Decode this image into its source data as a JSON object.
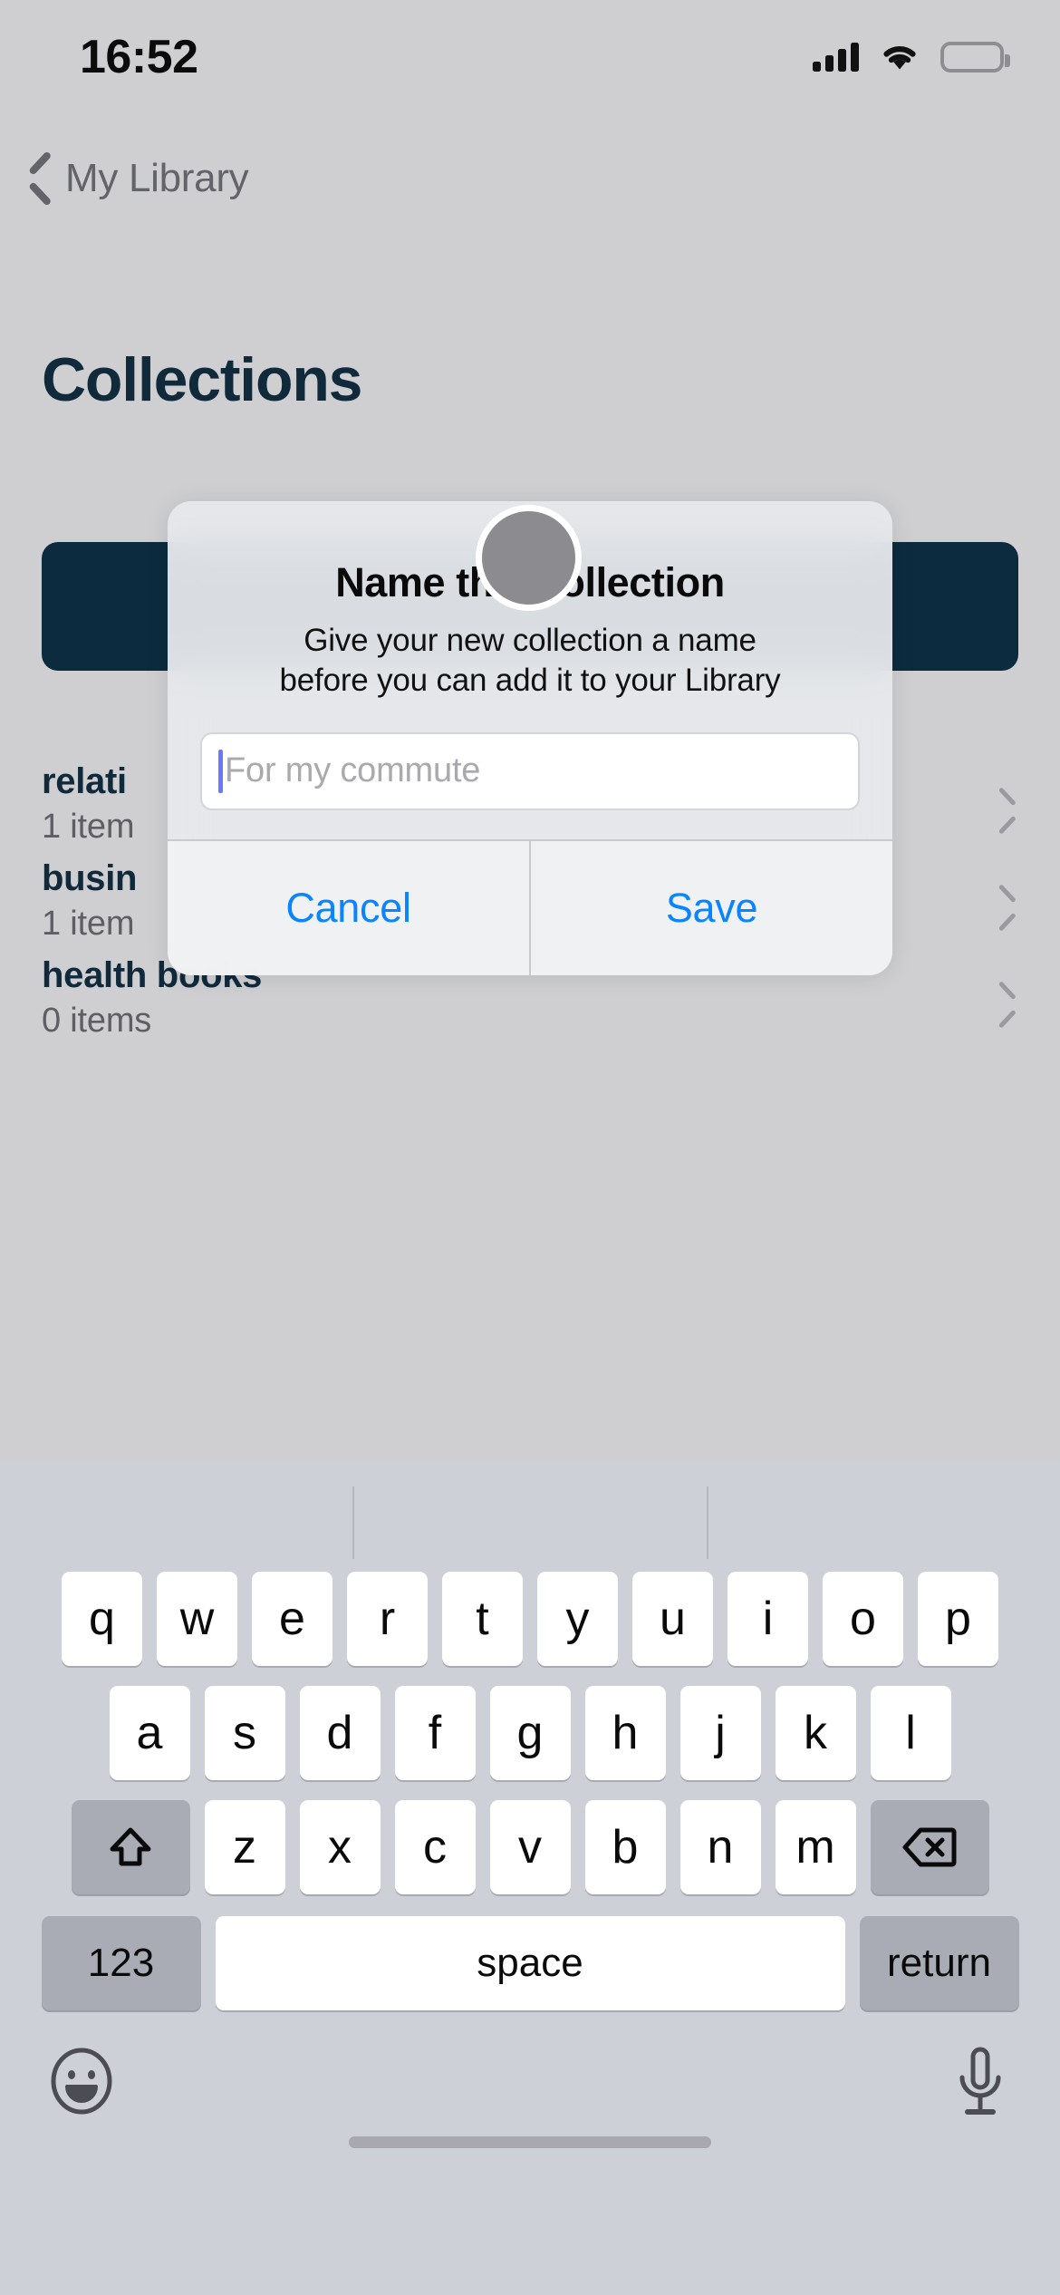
{
  "status_bar": {
    "time": "16:52",
    "signal_icon": "cellular-signal-icon",
    "wifi_icon": "wifi-icon",
    "battery_icon": "battery-icon",
    "battery_color": "#ffd60a"
  },
  "nav": {
    "back_label": "My Library",
    "back_icon": "chevron-left-icon"
  },
  "page": {
    "title": "Collections",
    "title_color": "#102a3c",
    "hero_card_color": "#0d2b3e"
  },
  "collections": [
    {
      "name": "relati",
      "count": "1 item",
      "chevron": "chevron-right-icon"
    },
    {
      "name": "busin",
      "count": "1 item",
      "chevron": "chevron-right-icon"
    },
    {
      "name": "health books",
      "count": "0 items",
      "chevron": "chevron-right-icon"
    }
  ],
  "alert": {
    "title": "Name this collection",
    "message": "Give your new collection a name\nbefore you can add it to your Library",
    "message_line1": "Give your new collection a name",
    "message_line2": "before you can add it to your Library",
    "input_value": "",
    "input_placeholder": "For my commute",
    "caret_color": "#6b78f7",
    "cancel_label": "Cancel",
    "save_label": "Save",
    "accent_color": "#0a84ff"
  },
  "keyboard": {
    "row1": [
      "q",
      "w",
      "e",
      "r",
      "t",
      "y",
      "u",
      "i",
      "o",
      "p"
    ],
    "row2": [
      "a",
      "s",
      "d",
      "f",
      "g",
      "h",
      "j",
      "k",
      "l"
    ],
    "row3": [
      "z",
      "x",
      "c",
      "v",
      "b",
      "n",
      "m"
    ],
    "shift_icon": "shift-arrow-icon",
    "backspace_icon": "backspace-delete-icon",
    "numbers_label": "123",
    "space_label": "space",
    "return_label": "return",
    "emoji_icon": "emoji-smiley-icon",
    "mic_icon": "microphone-icon"
  }
}
